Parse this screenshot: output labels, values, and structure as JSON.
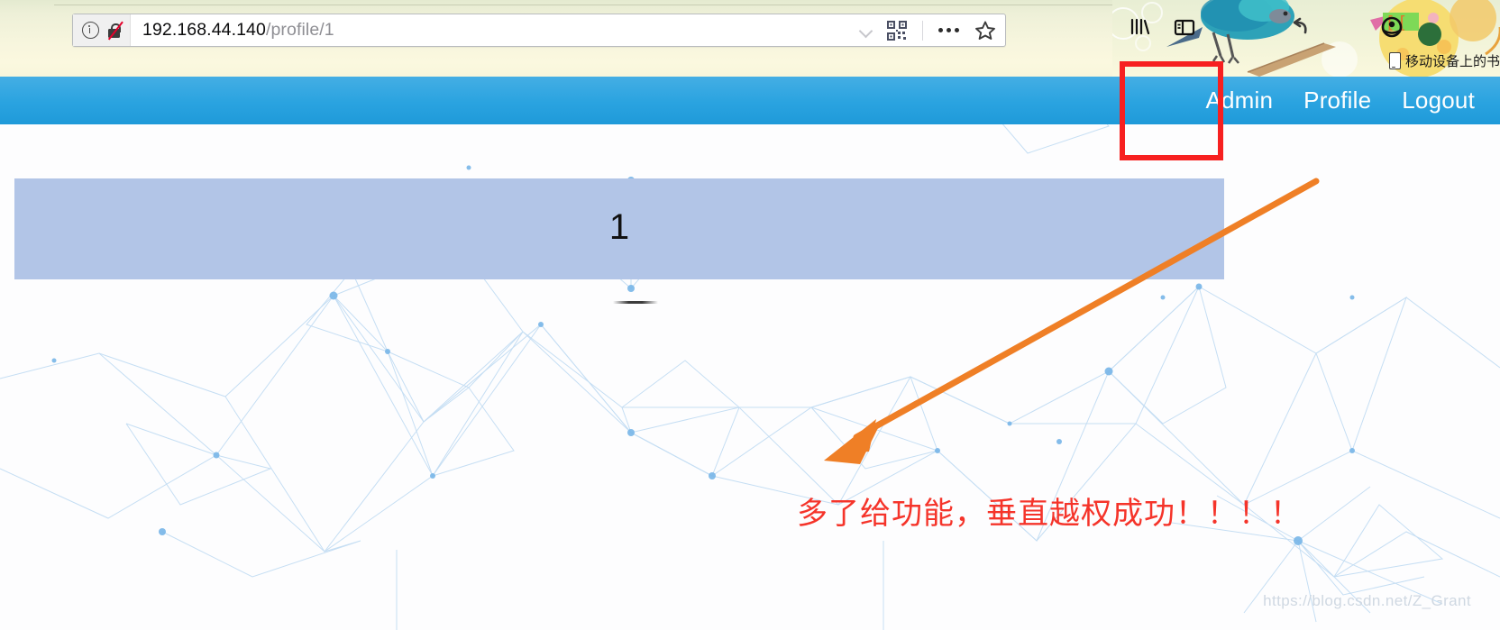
{
  "browser": {
    "url_host": "192.168.44.140",
    "url_path": "/profile/1",
    "icons": {
      "info": "info-icon",
      "insecure_lock": "crossed-lock-icon",
      "dropdown": "chevron-down-icon",
      "qr": "qr-code-icon",
      "page_actions": "ellipsis-icon",
      "bookmark_star": "star-icon",
      "library": "library-icon",
      "sidebar": "sidebar-icon",
      "back_history": "back-arrow-icon",
      "account": "account-icon"
    },
    "bookmark_bar": {
      "mobile_label": "移动设备上的书"
    }
  },
  "navbar": {
    "links": [
      {
        "label": "Admin"
      },
      {
        "label": "Profile"
      },
      {
        "label": "Logout"
      }
    ]
  },
  "content": {
    "panel_value": "1",
    "panel_color": "#b2c5e7"
  },
  "annotations": {
    "highlight_target": "Admin",
    "highlight_color": "#f72020",
    "arrow_color": "#ef7f26",
    "note_text": "多了给功能，垂直越权成功！！！！",
    "note_color": "#f5342a"
  },
  "watermark": {
    "text": "https://blog.csdn.net/Z_Grant"
  }
}
